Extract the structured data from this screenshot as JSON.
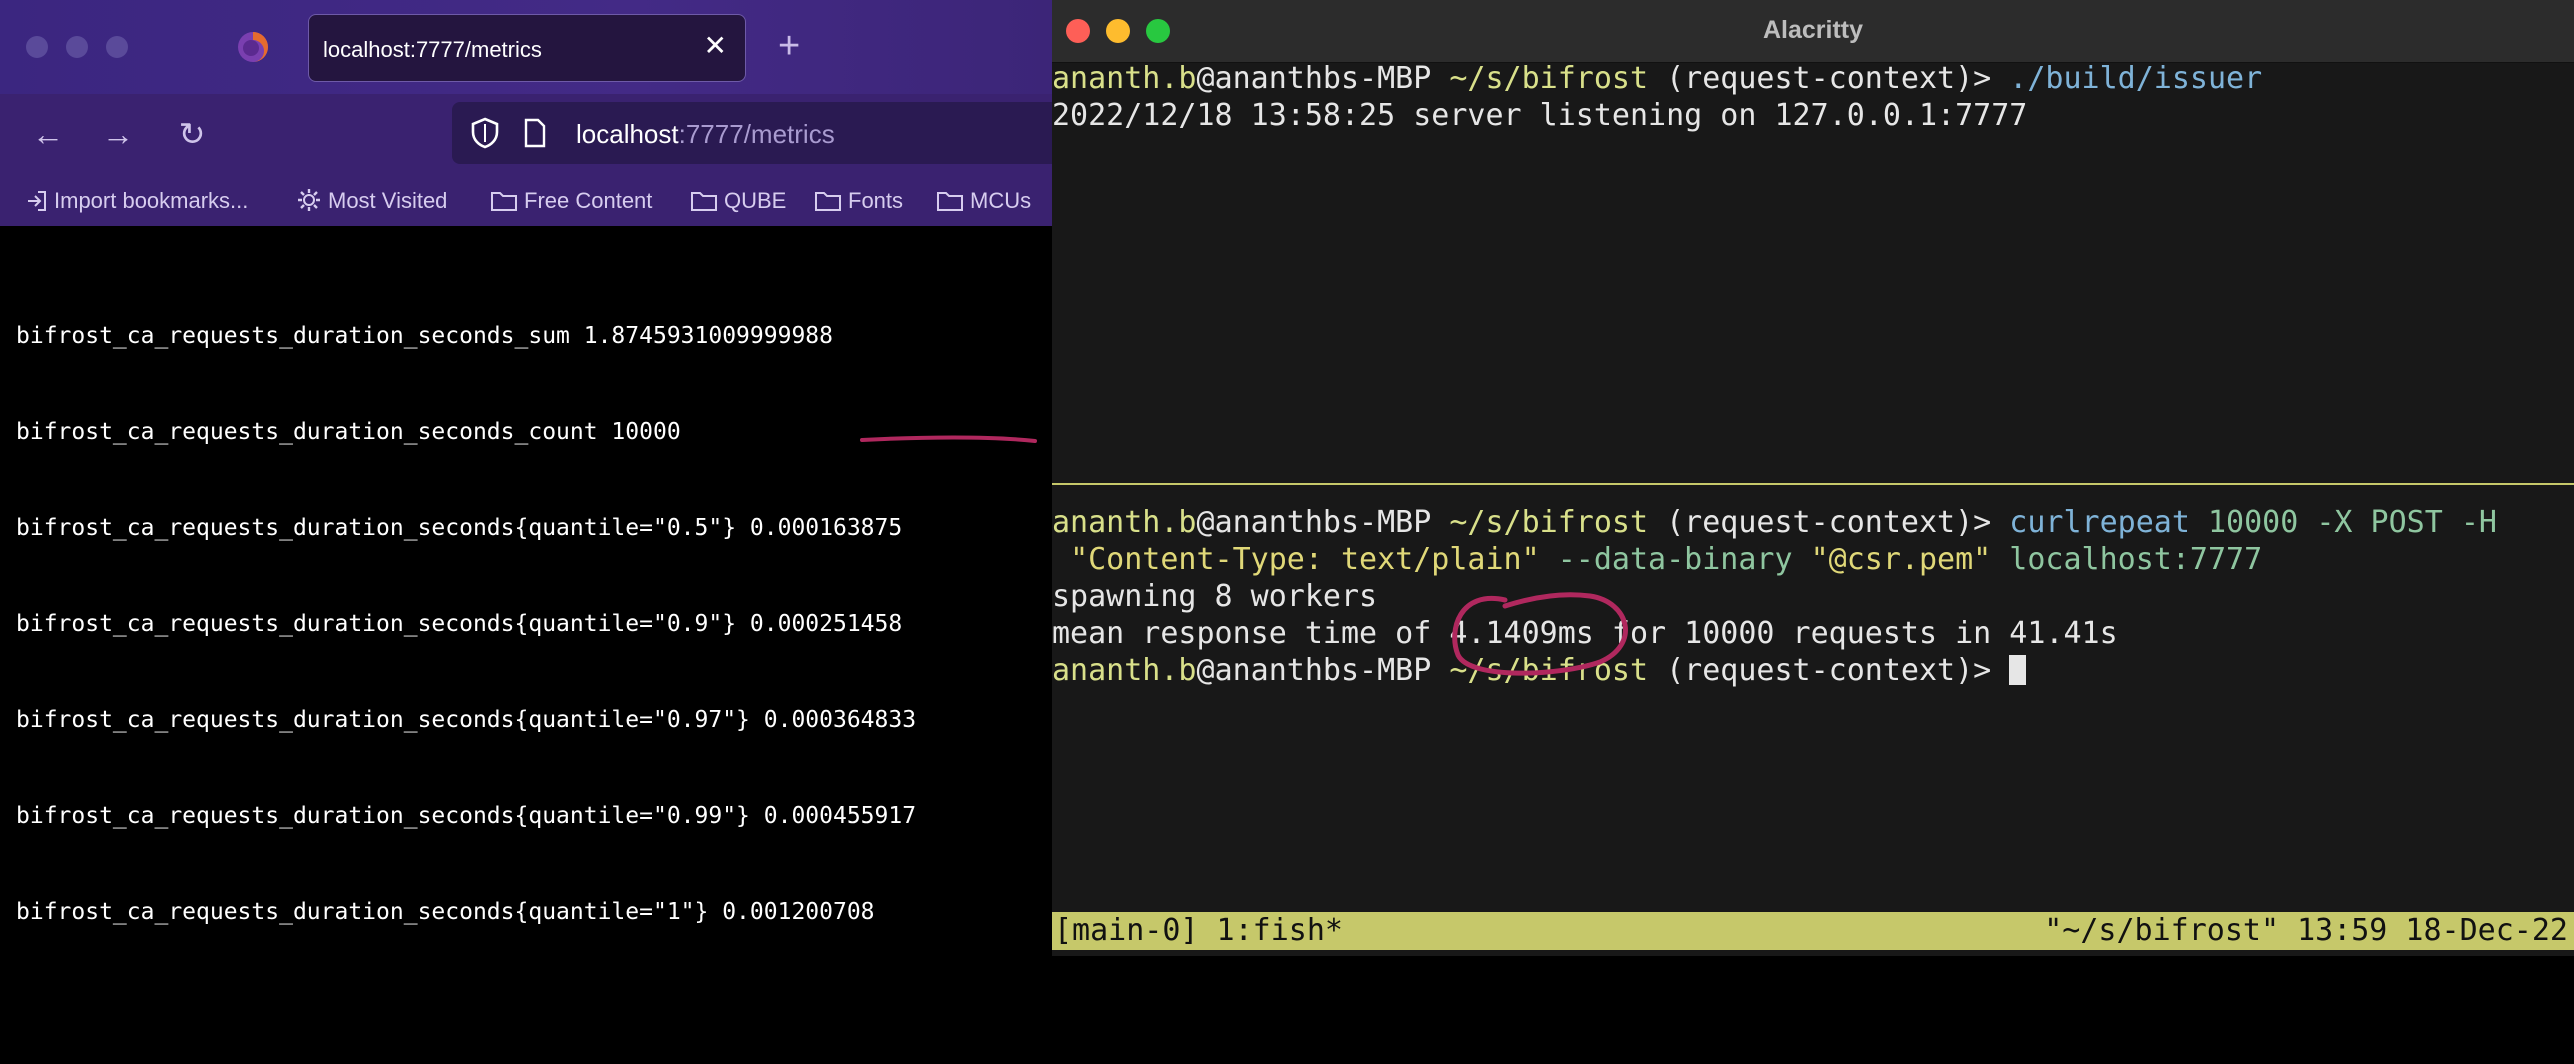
{
  "browser": {
    "tab_title": "localhost:7777/metrics",
    "tab_close": "✕",
    "new_tab": "+",
    "url_host": "localhost",
    "url_rest": ":7777/metrics",
    "bookmarks": [
      "Import bookmarks...",
      "Most Visited",
      "Free Content",
      "QUBE",
      "Fonts",
      "MCUs"
    ],
    "metrics_lines": [
      "bifrost_ca_requests_duration_seconds_sum 1.8745931009999988",
      "bifrost_ca_requests_duration_seconds_count 10000",
      "bifrost_ca_requests_duration_seconds{quantile=\"0.5\"} 0.000163875",
      "bifrost_ca_requests_duration_seconds{quantile=\"0.9\"} 0.000251458",
      "bifrost_ca_requests_duration_seconds{quantile=\"0.97\"} 0.000364833",
      "bifrost_ca_requests_duration_seconds{quantile=\"0.99\"} 0.000455917",
      "bifrost_ca_requests_duration_seconds{quantile=\"1\"} 0.001200708"
    ]
  },
  "terminal": {
    "title": "Alacritty",
    "prompt": {
      "user": "ananth.b",
      "at": "@",
      "host": "ananthbs-MBP",
      "path": "~/s/bifrost",
      "branch": "(request-context)",
      "symbol": ">"
    },
    "top_pane": {
      "command": "./build/issuer",
      "output": "2022/12/18 13:58:25 server listening on 127.0.0.1:7777"
    },
    "bottom_pane": {
      "cmd_name": "curlrepeat",
      "cmd_args1": "10000 -X POST -H",
      "cmd_str1": "\"Content-Type: text/plain\"",
      "cmd_args2": "--data-binary",
      "cmd_str2": "\"@csr.pem\"",
      "cmd_args3": "localhost:7777",
      "output1": "spawning 8 workers",
      "output2_pre": "mean response time of ",
      "output2_value": "4.1409ms",
      "output2_post": " for 10000 requests in 41.41s"
    },
    "status_left": "[main-0] 1:fish*",
    "status_right": "\"~/s/bifrost\" 13:59 18-Dec-22"
  },
  "colors": {
    "annotation": "#b0285e",
    "tmux_status": "#c6c86a",
    "browser_purple": "#3a2270"
  }
}
